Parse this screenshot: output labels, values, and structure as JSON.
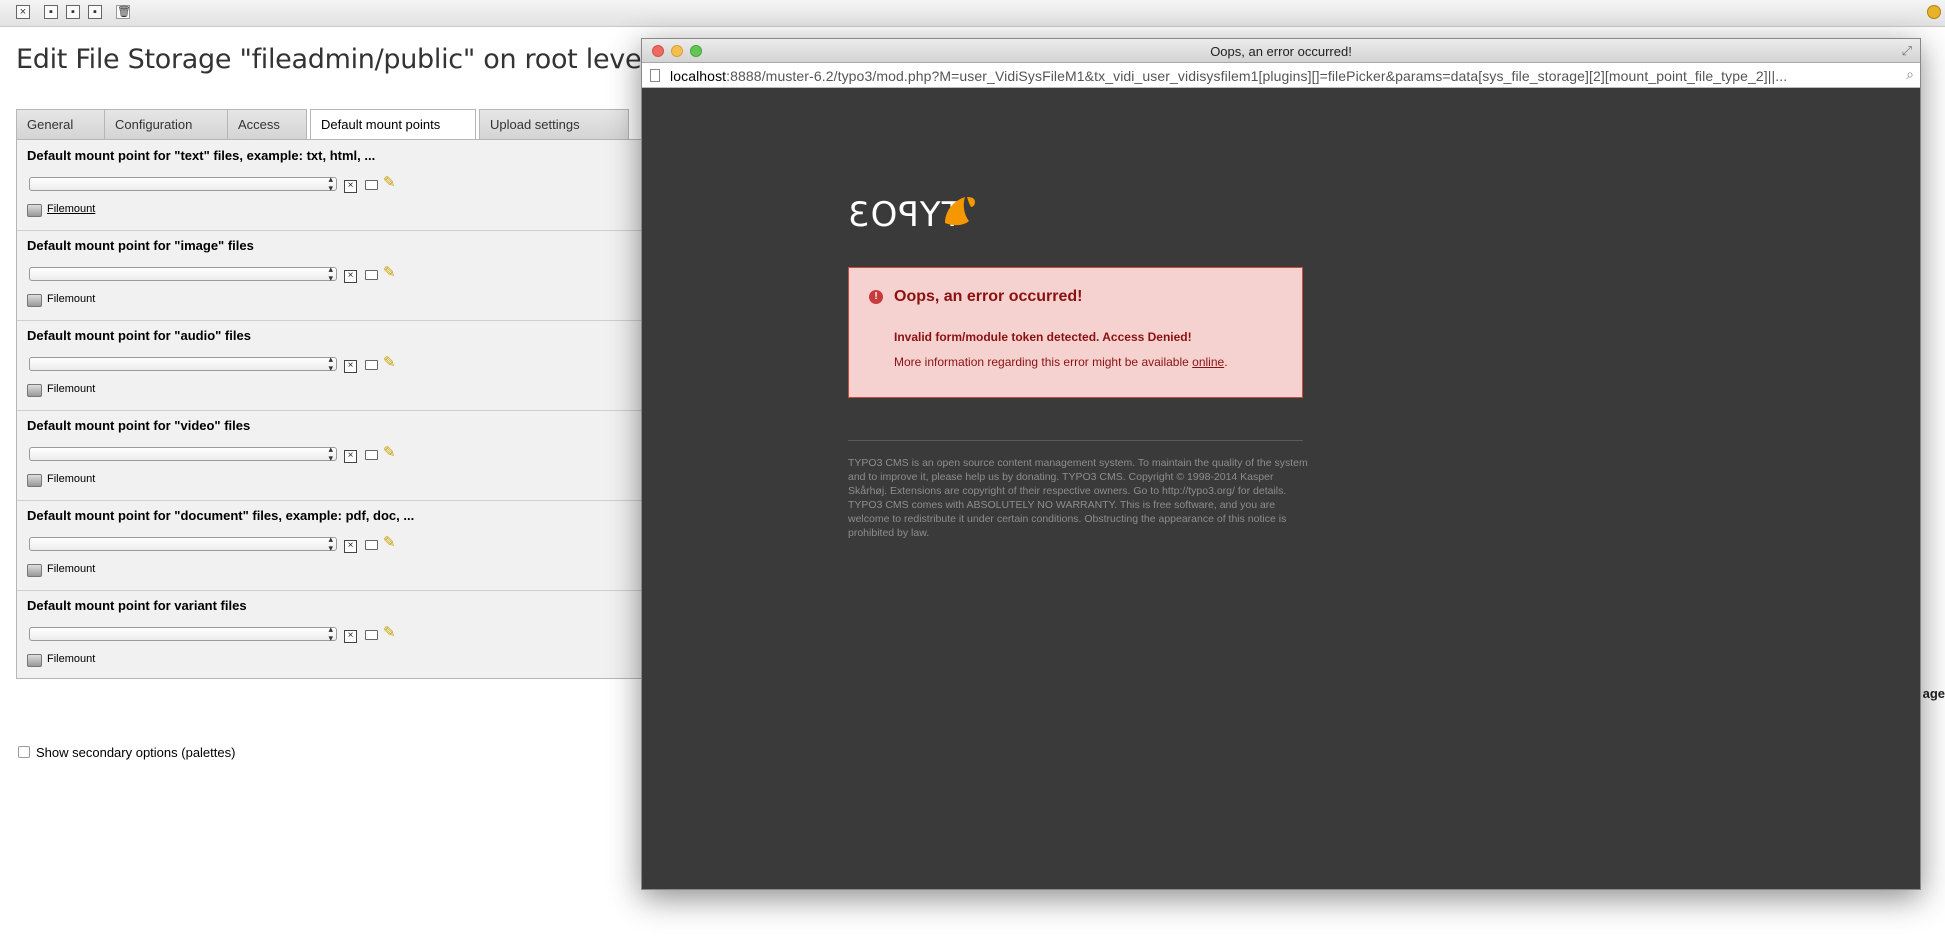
{
  "toolbar": {
    "icons": [
      "close-icon",
      "save-icon",
      "save-view-icon",
      "save-close-icon",
      "delete-icon"
    ]
  },
  "page": {
    "title": "Edit File Storage \"fileadmin/public\" on root level"
  },
  "tabs": [
    {
      "label": "General",
      "active": false
    },
    {
      "label": "Configuration",
      "active": false
    },
    {
      "label": "Access",
      "active": false
    },
    {
      "label": "Default mount points",
      "active": true
    },
    {
      "label": "Upload settings",
      "active": false
    }
  ],
  "fields": [
    {
      "label": "Default mount point for \"text\" files, example: txt, html, ...",
      "filemount": "Filemount",
      "linked": true
    },
    {
      "label": "Default mount point for \"image\" files",
      "filemount": "Filemount",
      "linked": false
    },
    {
      "label": "Default mount point for \"audio\" files",
      "filemount": "Filemount",
      "linked": false
    },
    {
      "label": "Default mount point for \"video\" files",
      "filemount": "Filemount",
      "linked": false
    },
    {
      "label": "Default mount point for \"document\" files, example: pdf, doc, ...",
      "filemount": "Filemount",
      "linked": false
    },
    {
      "label": "Default mount point for variant files",
      "filemount": "Filemount",
      "linked": false
    }
  ],
  "palettes": {
    "label": "Show secondary options (palettes)"
  },
  "edge_fragment": "age",
  "popup": {
    "title": "Oops, an error occurred!",
    "url_host": "localhost",
    "url_rest": ":8888/muster-6.2/typo3/mod.php?M=user_VidiSysFileM1&tx_vidi_user_vidisysfilem1[plugins][]=filePicker&params=data[sys_file_storage][2][mount_point_file_type_2]||...",
    "logo_text": "TYPO3",
    "error": {
      "heading": "Oops, an error occurred!",
      "message": "Invalid form/module token detected. Access Denied!",
      "more_prefix": "More information regarding this error might be available ",
      "more_link": "online",
      "more_suffix": "."
    },
    "footer": "TYPO3 CMS is an open source content management system. To maintain the quality of the system and to improve it, please help us by donating. TYPO3 CMS. Copyright © 1998-2014 Kasper Skårhøj. Extensions are copyright of their respective owners. Go to http://typo3.org/ for details. TYPO3 CMS comes with ABSOLUTELY NO WARRANTY. This is free software, and you are welcome to redistribute it under certain conditions. Obstructing the appearance of this notice is prohibited by law."
  },
  "colors": {
    "popup_bg": "#3a3a3a",
    "error_bg": "#f5d2d0",
    "error_text": "#8b1111",
    "typo3_orange": "#f49700"
  }
}
